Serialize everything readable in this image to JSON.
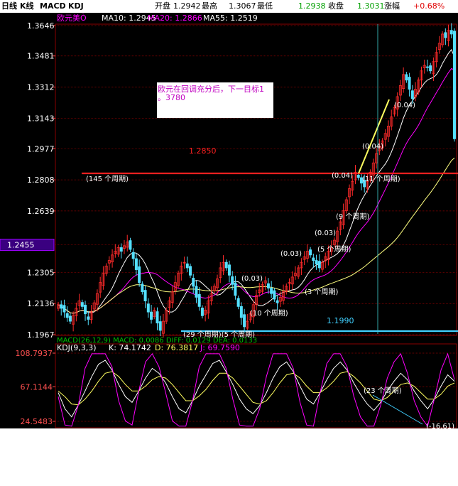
{
  "header": {
    "tab_daily": "日线",
    "tab_kline": "K线",
    "tab_macd": "MACD",
    "tab_kdj": "KDJ",
    "open_label": "开盘",
    "open_value": "1.2942",
    "high_label": "最高",
    "high_value": "1.3067",
    "low_label": "最低",
    "low_value": "1.2938",
    "close_label": "收盘",
    "close_value": "1.3031",
    "change_label": "涨幅",
    "change_value": "+0.68%"
  },
  "main_chart": {
    "symbol": "欧元美Ò",
    "ma10_label": "MA10: 1.2945",
    "ma20_label": "MA20: 1.2866",
    "ma55_label": "MA55: 1.2519",
    "y_ticks": [
      "1.3646",
      "1.3481",
      "1.3312",
      "1.3143",
      "1.2977",
      "1.2808",
      "1.2639",
      "1.2455",
      "1.2305",
      "1.2136",
      "1.1967"
    ],
    "highlight_tick": "1.2455",
    "note_line1": "欧元在回调充分后，下一目标1",
    "note_line2": "。3780",
    "level_1_2850": "1.2850",
    "level_1_1990": "1.1990",
    "annotations": [
      "(145 个周期)",
      "(0.04)",
      "(0.04)",
      "(0.04)",
      "(11 个周期)",
      "(9 个周期)",
      "(0.03)",
      "(0.03)",
      "(5 个周期)",
      "(0.03)",
      "(3 个周期)",
      "(10 个周期)",
      "(29 个周期)(5 个周期)"
    ]
  },
  "macd_strip": "MACD(26,12,9) MACD: 0.0086 DIFF: 0.0129 DEA: 0.0133",
  "kdj": {
    "label_kdj": "KDJ(9,3,3)",
    "label_k": "K: 74.1742",
    "label_d": "D: 76.3817",
    "label_j": "J: 69.7590",
    "y_ticks": [
      "108.7937",
      "67.1144",
      "24.5483"
    ],
    "annotations": [
      "(23 个周期)",
      "(-16.61)"
    ]
  },
  "colors": {
    "bg": "#000000",
    "grid": "#8a0000",
    "up": "#ff2a2a",
    "down": "#54e0ff",
    "ma10": "#ffffff",
    "ma20": "#ff00ff",
    "ma55": "#ffff80",
    "tick": "#ff5050",
    "label_white": "#ffffff",
    "open_value": "#ffffff",
    "high_value": "#ff3030",
    "low_value": "#00e000",
    "close_value": "#00e000",
    "change_value": "#ff3030",
    "note_text": "#c000c0",
    "level_text": "#ff2020",
    "cyan_text": "#40d0ff"
  },
  "chart_data": [
    {
      "type": "candlestick",
      "title": "欧元美Ò",
      "ylim": [
        1.1967,
        1.3646
      ],
      "closes": [
        1.213,
        1.211,
        1.209,
        1.206,
        1.204,
        1.207,
        1.211,
        1.215,
        1.212,
        1.208,
        1.205,
        1.209,
        1.214,
        1.219,
        1.225,
        1.23,
        1.234,
        1.237,
        1.24,
        1.242,
        1.244,
        1.242,
        1.245,
        1.247,
        1.243,
        1.238,
        1.232,
        1.225,
        1.22,
        1.215,
        1.209,
        1.205,
        1.21,
        1.203,
        1.199,
        1.204,
        1.21,
        1.215,
        1.22,
        1.225,
        1.23,
        1.234,
        1.236,
        1.233,
        1.229,
        1.223,
        1.217,
        1.212,
        1.207,
        1.21,
        1.215,
        1.219,
        1.223,
        1.227,
        1.233,
        1.236,
        1.233,
        1.229,
        1.224,
        1.218,
        1.212,
        1.206,
        1.201,
        1.204,
        1.208,
        1.213,
        1.218,
        1.221,
        1.224,
        1.226,
        1.222,
        1.219,
        1.216,
        1.214,
        1.217,
        1.22,
        1.223,
        1.225,
        1.228,
        1.23,
        1.233,
        1.236,
        1.239,
        1.242,
        1.24,
        1.237,
        1.235,
        1.233,
        1.236,
        1.239,
        1.242,
        1.244,
        1.248,
        1.253,
        1.258,
        1.264,
        1.27,
        1.276,
        1.28,
        1.285,
        1.282,
        1.279,
        1.277,
        1.28,
        1.285,
        1.29,
        1.295,
        1.299,
        1.302,
        1.306,
        1.31,
        1.315,
        1.32,
        1.326,
        1.332,
        1.338,
        1.335,
        1.33,
        1.325,
        1.33,
        1.335,
        1.34,
        1.343,
        1.342,
        1.34,
        1.345,
        1.35,
        1.355,
        1.36,
        1.358,
        1.362,
        1.36,
        1.3031
      ]
    },
    {
      "type": "line",
      "title": "KDJ(9,3,3)",
      "ylim": [
        24.5483,
        108.7937
      ],
      "series": [
        {
          "name": "K",
          "values": [
            60,
            40,
            30,
            45,
            62,
            80,
            95,
            100,
            88,
            70,
            55,
            48,
            62,
            78,
            90,
            84,
            72,
            55,
            40,
            35,
            50,
            68,
            82,
            96,
            100,
            86,
            70,
            52,
            40,
            34,
            44,
            60,
            78,
            92,
            98,
            86,
            68,
            52,
            46,
            60,
            76,
            90,
            98,
            88,
            72,
            58,
            46,
            38,
            48,
            62,
            74,
            84,
            76,
            62,
            50,
            40,
            52,
            68,
            82,
            74
          ]
        },
        {
          "name": "D",
          "values": [
            62,
            55,
            46,
            45,
            52,
            62,
            74,
            84,
            86,
            80,
            70,
            62,
            62,
            68,
            76,
            80,
            78,
            70,
            60,
            50,
            50,
            56,
            64,
            75,
            84,
            84,
            78,
            68,
            58,
            48,
            46,
            50,
            60,
            72,
            82,
            84,
            78,
            68,
            60,
            60,
            66,
            74,
            84,
            86,
            80,
            72,
            62,
            52,
            50,
            54,
            62,
            70,
            72,
            68,
            60,
            52,
            52,
            58,
            68,
            72
          ]
        },
        {
          "name": "J",
          "values": [
            55,
            20,
            5,
            45,
            90,
            108,
            108,
            108,
            92,
            50,
            25,
            20,
            62,
            98,
            108,
            92,
            60,
            25,
            5,
            10,
            50,
            92,
            108,
            108,
            108,
            90,
            52,
            20,
            5,
            8,
            40,
            80,
            108,
            108,
            108,
            90,
            48,
            20,
            18,
            60,
            96,
            108,
            108,
            92,
            56,
            30,
            14,
            10,
            44,
            78,
            98,
            108,
            84,
            50,
            30,
            16,
            52,
            88,
            108,
            76
          ]
        }
      ]
    }
  ]
}
